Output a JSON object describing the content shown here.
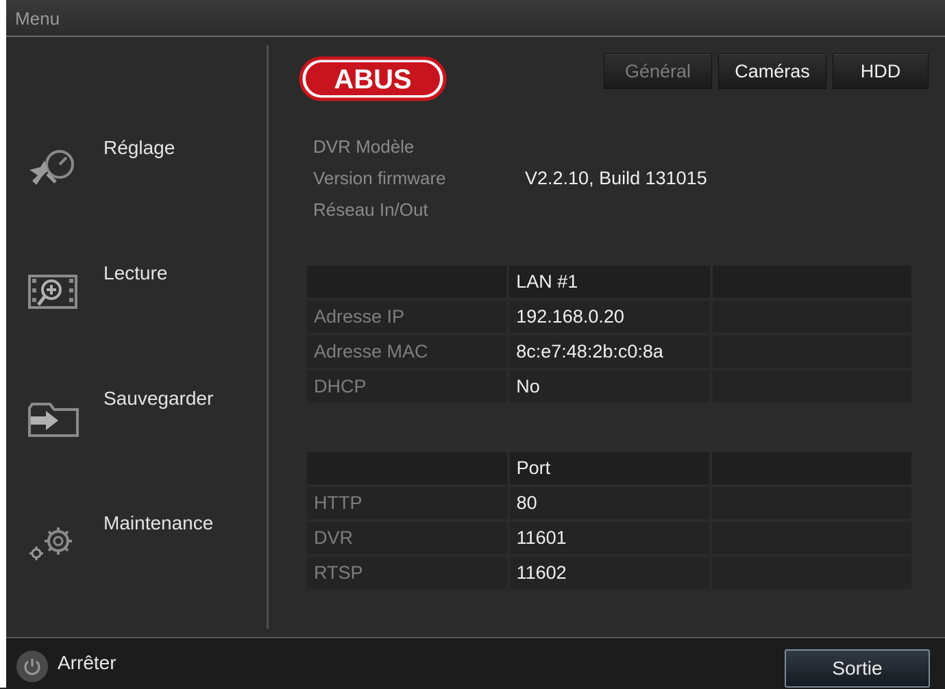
{
  "topbar": {
    "title": "Menu"
  },
  "sidebar": {
    "items": [
      {
        "label": "Réglage",
        "icon": "settings-tools-icon"
      },
      {
        "label": "Lecture",
        "icon": "playback-film-icon"
      },
      {
        "label": "Sauvegarder",
        "icon": "backup-export-icon"
      },
      {
        "label": "Maintenance",
        "icon": "maintenance-gears-icon"
      }
    ]
  },
  "logo": {
    "text": "ABUS",
    "color": "#c8141e"
  },
  "tabs": [
    {
      "label": "Général",
      "state": "disabled"
    },
    {
      "label": "Caméras",
      "state": "normal"
    },
    {
      "label": "HDD",
      "state": "normal"
    }
  ],
  "info": {
    "model_label": "DVR Modèle",
    "firmware_label": "Version firmware",
    "firmware_value": "V2.2.10, Build 131015",
    "network_label": "Réseau In/Out"
  },
  "lan_table": {
    "header": "LAN #1",
    "rows": [
      {
        "key": "Adresse IP",
        "value": "192.168.0.20"
      },
      {
        "key": "Adresse MAC",
        "value": "8c:e7:48:2b:c0:8a"
      },
      {
        "key": "DHCP",
        "value": "No"
      }
    ]
  },
  "port_table": {
    "header": "Port",
    "rows": [
      {
        "key": "HTTP",
        "value": "80"
      },
      {
        "key": "DVR",
        "value": "11601"
      },
      {
        "key": "RTSP",
        "value": "11602"
      }
    ]
  },
  "footer": {
    "shutdown_label": "Arrêter",
    "exit_label": "Sortie"
  }
}
